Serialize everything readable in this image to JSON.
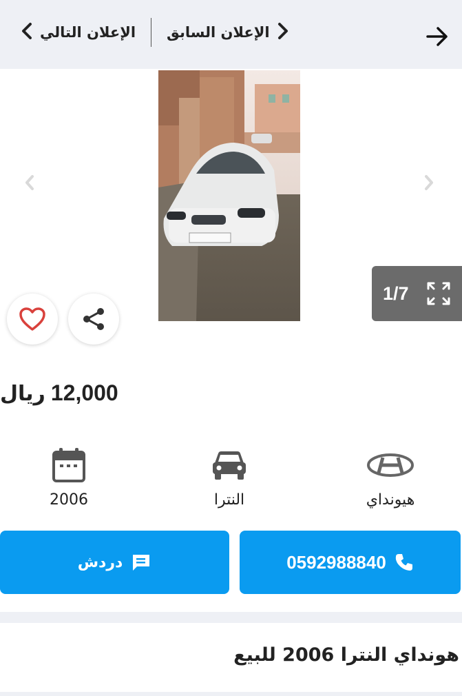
{
  "topbar": {
    "next_label": "الإعلان التالي",
    "prev_label": "الإعلان السابق"
  },
  "gallery": {
    "counter": "1/7"
  },
  "listing": {
    "price_amount": "12,000",
    "price_currency": "ريال",
    "title": "هونداي النترا 2006 للبيع"
  },
  "specs": {
    "year": "2006",
    "model": "النترا",
    "make": "هيونداي"
  },
  "actions": {
    "chat_label": "دردش",
    "phone_label": "0592988840"
  },
  "colors": {
    "accent": "#0a9bf0",
    "topbar_bg": "#eef0f5",
    "heart": "#d9413c"
  },
  "icons": [
    "back-arrow-icon",
    "chevron-left-icon",
    "chevron-right-icon",
    "expand-icon",
    "heart-icon",
    "share-icon",
    "calendar-icon",
    "car-icon",
    "hyundai-logo-icon",
    "chat-icon",
    "phone-icon"
  ]
}
